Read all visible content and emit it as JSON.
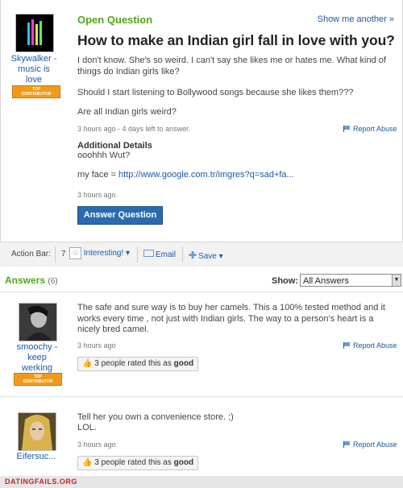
{
  "question": {
    "status": "Open Question",
    "show_another": "Show me another »",
    "title": "How to make an Indian girl fall in love with you?",
    "paragraphs": [
      "I don't know. She's so weird. I can't say she likes me or hates me. What kind of things do Indian girls like?",
      "Should I start listening to Bollywood songs because she likes them???",
      "Are all Indian girls weird?"
    ],
    "meta": "3 hours ago - 4 days left to answer.",
    "report": "Report Abuse",
    "additional_details_label": "Additional Details",
    "additional_details_text": "ooohhh Wut?",
    "face_prefix": "my face = ",
    "face_link": "http://www.google.com.tr/imgres?q=sad+fa...",
    "additional_meta": "3 hours ago",
    "answer_button": "Answer Question",
    "user": {
      "name_line1": "Skywalker -",
      "name_line2": "music is",
      "name_line3": "love",
      "badge_line1": "TOP",
      "badge_line2": "CONTRIBUTOR"
    }
  },
  "action_bar": {
    "label": "Action Bar:",
    "interesting_count": "7",
    "interesting": "Interesting! ▾",
    "email": "Email",
    "save": "Save ▾"
  },
  "answers_header": {
    "title": "Answers",
    "count": "(6)",
    "show_label": "Show:",
    "show_value": "All Answers"
  },
  "answers": [
    {
      "user_line1": "smoochy -",
      "user_line2": "keep",
      "user_line3": "werking",
      "badge_line1": "TOP",
      "badge_line2": "CONTRIBUTOR",
      "text": "The safe and sure way is to buy her camels. This a 100% tested method and it works every time , not just with Indian girls. The way to a person's heart is a nicely bred camel.",
      "meta": "3 hours ago",
      "report": "Report Abuse",
      "rated_prefix": "3 people rated this as",
      "rated_word": "good"
    },
    {
      "user_line1": "Eifersuc...",
      "text_line1": "Tell her you own a convenience store. ;)",
      "text_line2": "LOL.",
      "meta": "3 hours ago",
      "report": "Report Abuse",
      "rated_prefix": "3 people rated this as",
      "rated_word": "good"
    }
  ],
  "footer": {
    "logo": "DATINGFAILS.ORG"
  },
  "colors": {
    "green": "#4fa814",
    "link": "#1a5aa6",
    "button": "#2a6bb0",
    "badge": "#f19a1a"
  }
}
